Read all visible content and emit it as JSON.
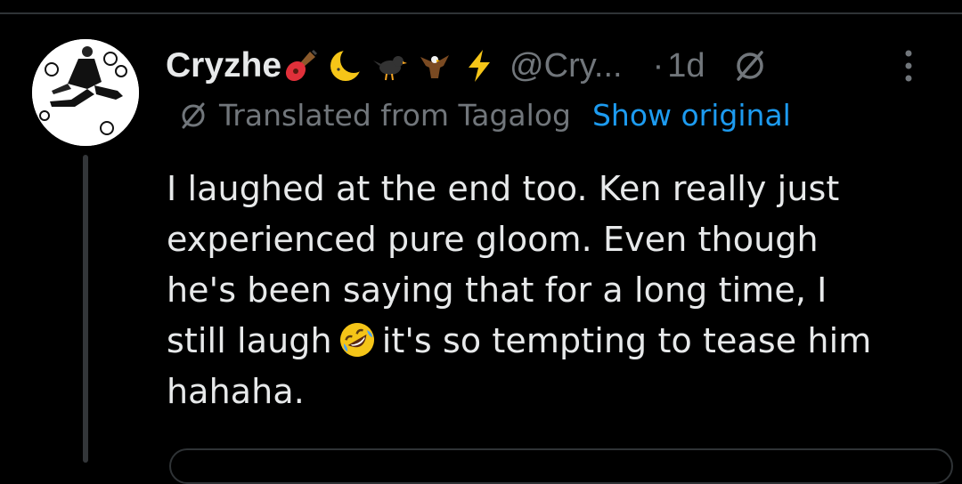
{
  "tweet": {
    "author_name": "Cryzhe",
    "name_emojis": [
      "guitar-emoji",
      "crescent-moon-emoji",
      "black-bird-emoji",
      "eagle-emoji",
      "lightning-emoji"
    ],
    "handle": "@Cry...",
    "separator": "·",
    "timestamp": "1d",
    "translation_label": "Translated from Tagalog",
    "show_original_label": "Show original",
    "body_lines": [
      "I laughed at the end too. Ken really just",
      "experienced pure gloom. Even though",
      "he's been saying that for a long time, I"
    ],
    "body_line4_before": "still laugh",
    "body_line4_after": "it's so tempting to tease him",
    "body_line5": "hahaha.",
    "inline_emoji": "rolling-on-floor-laughing-emoji"
  },
  "colors": {
    "background": "#000000",
    "text": "#e7e9ea",
    "muted": "#71767b",
    "link": "#1d9bf0",
    "border": "#2f3336"
  }
}
